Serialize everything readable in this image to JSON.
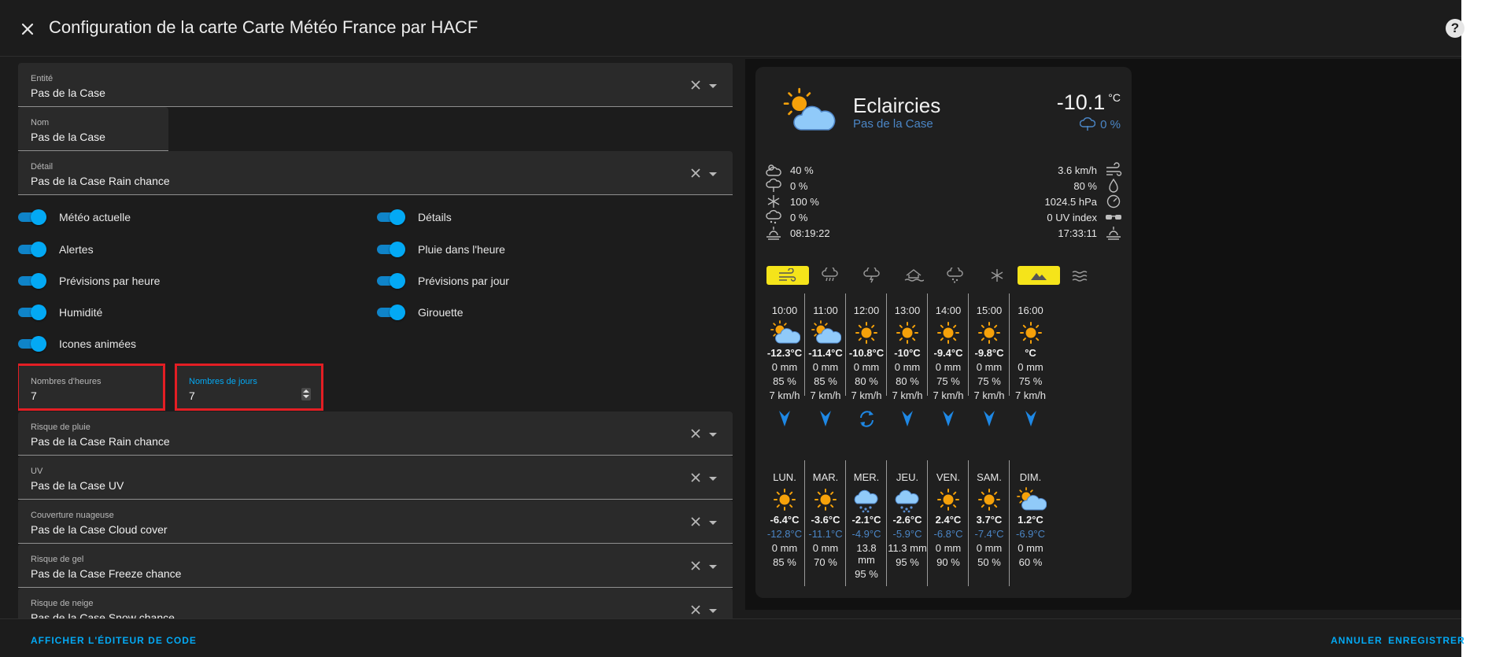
{
  "dialog": {
    "title": "Configuration de la carte Carte Météo France par HACF",
    "help": "?",
    "show_code_label": "AFFICHER L'ÉDITEUR DE CODE",
    "cancel_label": "ANNULER",
    "save_label": "ENREGISTRER"
  },
  "editor": {
    "entity": {
      "label": "Entité",
      "value": "Pas de la Case"
    },
    "name": {
      "label": "Nom",
      "value": "Pas de la Case"
    },
    "detail": {
      "label": "Détail",
      "value": "Pas de la Case Rain chance"
    },
    "toggles": {
      "current": "Météo actuelle",
      "details": "Détails",
      "alerts": "Alertes",
      "one_hour": "Pluie dans l'heure",
      "hourly": "Prévisions par heure",
      "daily": "Prévisions par jour",
      "humidity": "Humidité",
      "wind_vane": "Girouette",
      "animated": "Icones animées"
    },
    "hours": {
      "label": "Nombres d'heures",
      "value": "7"
    },
    "days": {
      "label": "Nombres de jours",
      "value": "7"
    },
    "rain": {
      "label": "Risque de pluie",
      "value": "Pas de la Case Rain chance"
    },
    "uv": {
      "label": "UV",
      "value": "Pas de la Case UV"
    },
    "cloud": {
      "label": "Couverture nuageuse",
      "value": "Pas de la Case Cloud cover"
    },
    "freeze": {
      "label": "Risque de gel",
      "value": "Pas de la Case Freeze chance"
    },
    "snow": {
      "label": "Risque de neige",
      "value": "Pas de la Case Snow chance"
    }
  },
  "card": {
    "condition": "Eclaircies",
    "name": "Pas de la Case",
    "temperature": "-10.1",
    "unit": "°C",
    "rain_chance": "0 %",
    "details_left": [
      "40 %",
      "0 %",
      "100 %",
      "0 %",
      "08:19:22"
    ],
    "details_right": [
      "3.6 km/h",
      "80 %",
      "1024.5 hPa",
      "0 UV index",
      "17:33:11"
    ],
    "alerts_active": [
      true,
      false,
      false,
      false,
      false,
      false,
      true,
      false
    ],
    "alerts_active_color": "#f5e41a",
    "hourly": [
      {
        "time": "10:00",
        "icon": "partly-cloudy",
        "temp": "-12.3°C",
        "rain": "0 mm",
        "humidity": "85 %",
        "wind": "7 km/h",
        "wind_icon": "wind-arrow"
      },
      {
        "time": "11:00",
        "icon": "partly-cloudy",
        "temp": "-11.4°C",
        "rain": "0 mm",
        "humidity": "85 %",
        "wind": "7 km/h",
        "wind_icon": "wind-arrow"
      },
      {
        "time": "12:00",
        "icon": "sunny",
        "temp": "-10.8°C",
        "rain": "0 mm",
        "humidity": "80 %",
        "wind": "7 km/h",
        "wind_icon": "wind-variable"
      },
      {
        "time": "13:00",
        "icon": "sunny",
        "temp": "-10°C",
        "rain": "0 mm",
        "humidity": "80 %",
        "wind": "7 km/h",
        "wind_icon": "wind-arrow"
      },
      {
        "time": "14:00",
        "icon": "sunny",
        "temp": "-9.4°C",
        "rain": "0 mm",
        "humidity": "75 %",
        "wind": "7 km/h",
        "wind_icon": "wind-arrow"
      },
      {
        "time": "15:00",
        "icon": "sunny",
        "temp": "-9.8°C",
        "rain": "0 mm",
        "humidity": "75 %",
        "wind": "7 km/h",
        "wind_icon": "wind-arrow"
      },
      {
        "time": "16:00",
        "icon": "sunny",
        "temp": "°C",
        "rain": "0 mm",
        "humidity": "75 %",
        "wind": "7 km/h",
        "wind_icon": "wind-arrow"
      }
    ],
    "daily": [
      {
        "day": "LUN.",
        "icon": "sunny",
        "max": "-6.4°C",
        "min": "-12.8°C",
        "rain": "0 mm",
        "humidity": "85 %"
      },
      {
        "day": "MAR.",
        "icon": "sunny",
        "max": "-3.6°C",
        "min": "-11.1°C",
        "rain": "0 mm",
        "humidity": "70 %"
      },
      {
        "day": "MER.",
        "icon": "snowy",
        "max": "-2.1°C",
        "min": "-4.9°C",
        "rain": "13.8 mm",
        "humidity": "95 %"
      },
      {
        "day": "JEU.",
        "icon": "snowy",
        "max": "-2.6°C",
        "min": "-5.9°C",
        "rain": "11.3 mm",
        "humidity": "95 %"
      },
      {
        "day": "VEN.",
        "icon": "sunny",
        "max": "2.4°C",
        "min": "-6.8°C",
        "rain": "0 mm",
        "humidity": "90 %"
      },
      {
        "day": "SAM.",
        "icon": "sunny",
        "max": "3.7°C",
        "min": "-7.4°C",
        "rain": "0 mm",
        "humidity": "50 %"
      },
      {
        "day": "DIM.",
        "icon": "partly-cloudy",
        "max": "1.2°C",
        "min": "-6.9°C",
        "rain": "0 mm",
        "humidity": "60 %"
      }
    ]
  },
  "colors": {
    "accent": "#03a9f4",
    "highlight": "#e31e24",
    "min_temp": "#4b86c6",
    "sun": "#f5a10a",
    "cloud": "#90caf9"
  }
}
